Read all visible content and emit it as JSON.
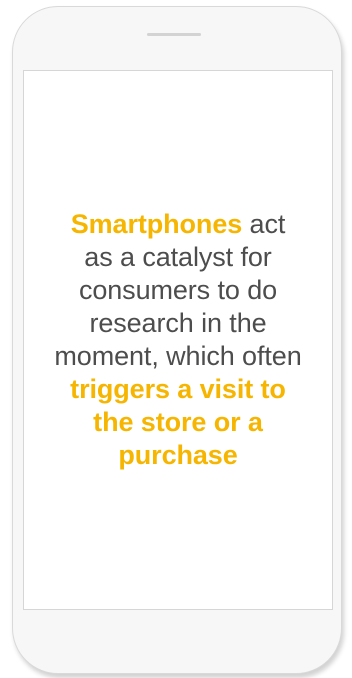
{
  "message": {
    "highlight_start": "Smartphones",
    "body": " act as a catalyst for consumers to do research in the moment, which often ",
    "highlight_end": "triggers a visit to the store or a purchase"
  },
  "colors": {
    "text": "#4d4d4d",
    "accent": "#f6b500",
    "phone_frame": "#f7f7f7"
  }
}
